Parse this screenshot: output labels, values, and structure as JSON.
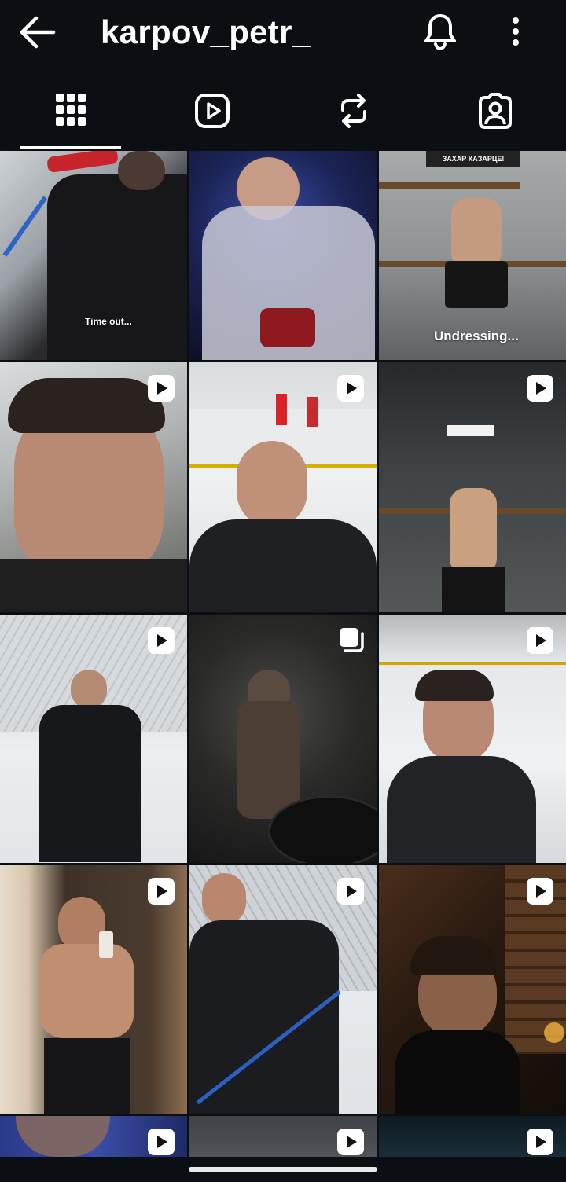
{
  "header": {
    "username": "karpov_petr_",
    "back_icon": "arrow-left-icon",
    "bell_icon": "bell-icon",
    "more_icon": "more-vertical-icon"
  },
  "tabs": [
    {
      "name": "posts",
      "icon": "grid-icon",
      "active": true
    },
    {
      "name": "reels",
      "icon": "reels-play-icon",
      "active": false
    },
    {
      "name": "reposts",
      "icon": "repost-icon",
      "active": false
    },
    {
      "name": "tagged",
      "icon": "tagged-person-icon",
      "active": false
    }
  ],
  "posts": [
    {
      "id": "p1",
      "caption": "Time out...",
      "badge": ""
    },
    {
      "id": "p2",
      "caption": "",
      "badge": ""
    },
    {
      "id": "p3",
      "caption": "Undressing...",
      "badge": "",
      "sign_text": "ЗАХАР КАЗАРЦЕ!"
    },
    {
      "id": "p4",
      "caption": "",
      "badge": "reel"
    },
    {
      "id": "p5",
      "caption": "",
      "badge": "reel"
    },
    {
      "id": "p6",
      "caption": "",
      "badge": "reel"
    },
    {
      "id": "p7",
      "caption": "",
      "badge": "reel"
    },
    {
      "id": "p8",
      "caption": "",
      "badge": "carousel"
    },
    {
      "id": "p9",
      "caption": "",
      "badge": "reel"
    },
    {
      "id": "p10",
      "caption": "",
      "badge": "reel"
    },
    {
      "id": "p11",
      "caption": "",
      "badge": "reel"
    },
    {
      "id": "p12",
      "caption": "",
      "badge": "reel"
    },
    {
      "id": "p13",
      "caption": "",
      "badge": "reel"
    },
    {
      "id": "p14",
      "caption": "",
      "badge": "reel"
    },
    {
      "id": "p15",
      "caption": "",
      "badge": "reel"
    }
  ],
  "colors": {
    "background": "#0b0f14",
    "foreground": "#ffffff"
  }
}
